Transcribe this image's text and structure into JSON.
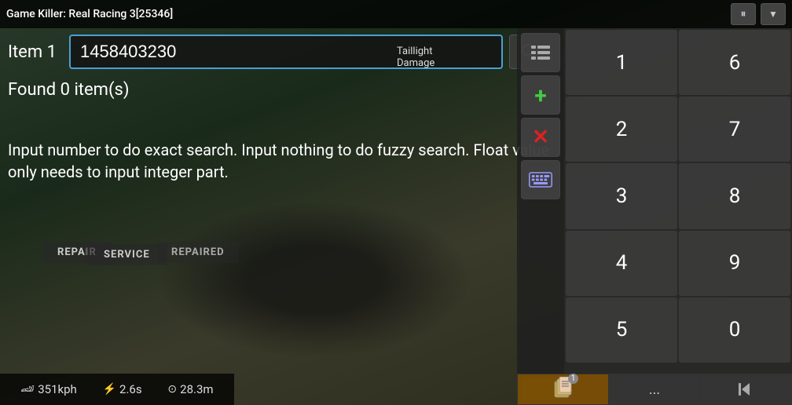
{
  "titleBar": {
    "title": "Game Killer: Real Racing 3[25346]",
    "pauseLabel": "⏸",
    "dropdownLabel": "▼"
  },
  "searchRow": {
    "itemLabel": "Item 1",
    "inputValue": "1458403230",
    "inputPlaceholder": ""
  },
  "foundText": "Found 0 item(s)",
  "hintText": "Input number to do exact search. Input nothing to do fuzzy search. Float value only needs to input integer part.",
  "repairLabel": "REPAIR",
  "repairedLabel": "REPAIRED",
  "serviceLabel": "SERVICE",
  "taillightLabel": "Taillight Damage",
  "statusBar": {
    "speed": "351kph",
    "time": "2.6s",
    "distance": "28.3m"
  },
  "numpad": {
    "keys": [
      "1",
      "6",
      "2",
      "7",
      "3",
      "8",
      "4",
      "9",
      "5",
      "0"
    ]
  },
  "toolbar": {
    "listIcon": "list-icon",
    "addLabel": "+",
    "deleteLabel": "✕",
    "keyboardIcon": "keyboard-icon"
  },
  "bottomToolbar": {
    "fileBadge": "1",
    "dotsLabel": "...",
    "backLabel": "⏮"
  }
}
